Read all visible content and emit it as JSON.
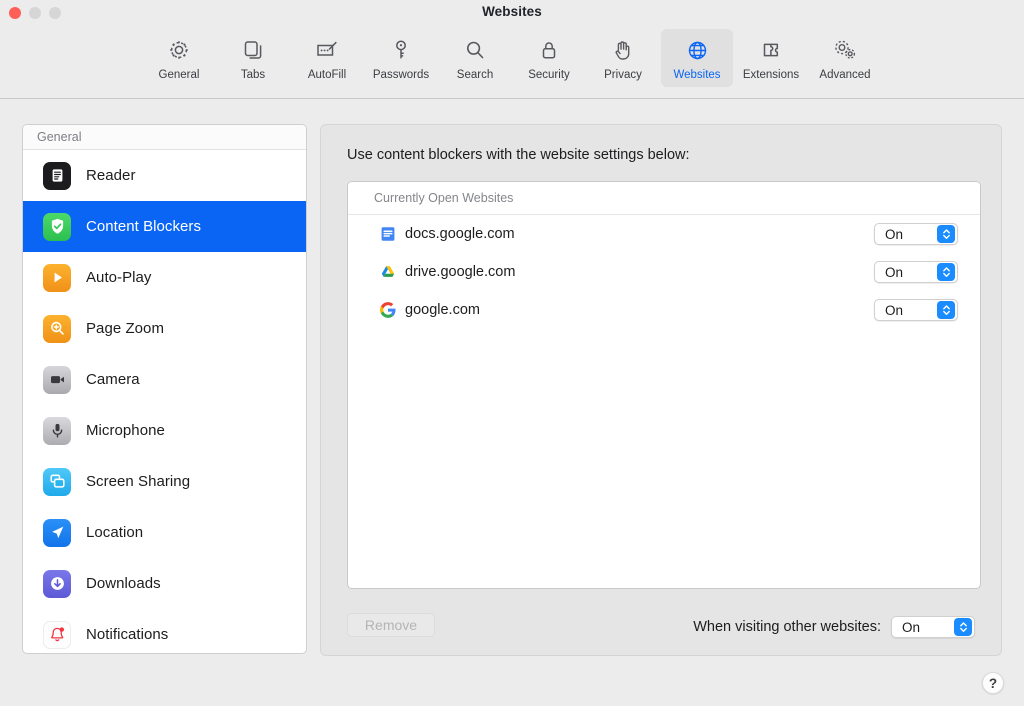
{
  "window": {
    "title": "Websites",
    "traffic_lights": [
      "close",
      "minimize",
      "maximize"
    ]
  },
  "toolbar": {
    "items": [
      {
        "label": "General",
        "icon": "gear-icon",
        "selected": false
      },
      {
        "label": "Tabs",
        "icon": "tabs-icon",
        "selected": false
      },
      {
        "label": "AutoFill",
        "icon": "autofill-icon",
        "selected": false
      },
      {
        "label": "Passwords",
        "icon": "key-icon",
        "selected": false
      },
      {
        "label": "Search",
        "icon": "search-icon",
        "selected": false
      },
      {
        "label": "Security",
        "icon": "lock-icon",
        "selected": false
      },
      {
        "label": "Privacy",
        "icon": "hand-icon",
        "selected": false
      },
      {
        "label": "Websites",
        "icon": "globe-icon",
        "selected": true
      },
      {
        "label": "Extensions",
        "icon": "puzzle-icon",
        "selected": false
      },
      {
        "label": "Advanced",
        "icon": "gears-icon",
        "selected": false
      }
    ]
  },
  "sidebar": {
    "header": "General",
    "items": [
      {
        "label": "Reader",
        "icon": "reader-icon",
        "selected": false
      },
      {
        "label": "Content Blockers",
        "icon": "shield-check-icon",
        "selected": true
      },
      {
        "label": "Auto-Play",
        "icon": "play-icon",
        "selected": false
      },
      {
        "label": "Page Zoom",
        "icon": "magnifier-plus-icon",
        "selected": false
      },
      {
        "label": "Camera",
        "icon": "camera-icon",
        "selected": false
      },
      {
        "label": "Microphone",
        "icon": "microphone-icon",
        "selected": false
      },
      {
        "label": "Screen Sharing",
        "icon": "screen-share-icon",
        "selected": false
      },
      {
        "label": "Location",
        "icon": "location-arrow-icon",
        "selected": false
      },
      {
        "label": "Downloads",
        "icon": "download-icon",
        "selected": false
      },
      {
        "label": "Notifications",
        "icon": "bell-icon",
        "selected": false
      }
    ]
  },
  "main": {
    "description": "Use content blockers with the website settings below:",
    "list_header": "Currently Open Websites",
    "sites": [
      {
        "name": "docs.google.com",
        "favicon": "google-docs-icon",
        "setting": "On"
      },
      {
        "name": "drive.google.com",
        "favicon": "google-drive-icon",
        "setting": "On"
      },
      {
        "name": "google.com",
        "favicon": "google-g-icon",
        "setting": "On"
      }
    ],
    "remove_label": "Remove",
    "other_sites_label": "When visiting other websites:",
    "other_sites_value": "On"
  },
  "help": {
    "label": "?"
  },
  "colors": {
    "accent": "#0a65f4",
    "popup_arrow_blue": "#1a8cff",
    "window_bg": "#ececec",
    "panel_bg": "#e5e5e5",
    "list_bg": "#ffffff"
  }
}
